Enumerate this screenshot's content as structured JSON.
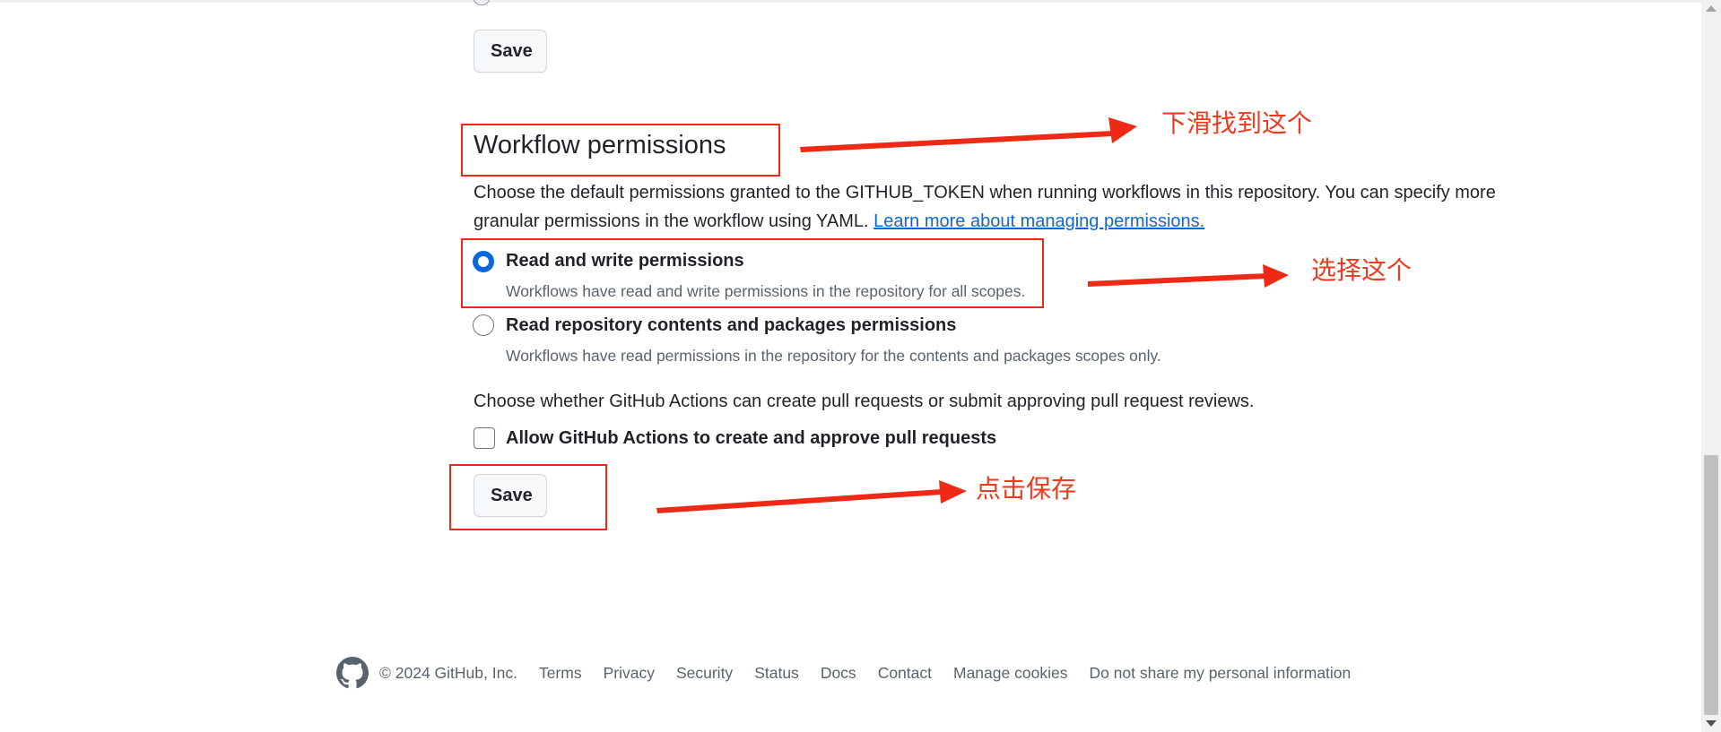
{
  "top": {
    "save_label": "Save"
  },
  "workflow": {
    "title": "Workflow permissions",
    "description": "Choose the default permissions granted to the GITHUB_TOKEN when running workflows in this repository. You can specify more granular permissions in the workflow using YAML. ",
    "learn_more_link": "Learn more about managing permissions.",
    "options": [
      {
        "label": "Read and write permissions",
        "note": "Workflows have read and write permissions in the repository for all scopes.",
        "selected": true
      },
      {
        "label": "Read repository contents and packages permissions",
        "note": "Workflows have read permissions in the repository for the contents and packages scopes only.",
        "selected": false
      }
    ],
    "pr_description": "Choose whether GitHub Actions can create pull requests or submit approving pull request reviews.",
    "allow_pr_label": "Allow GitHub Actions to create and approve pull requests",
    "allow_pr_checked": false,
    "save_label": "Save"
  },
  "annotations": {
    "scroll_hint": "下滑找到这个",
    "select_hint": "选择这个",
    "save_hint": "点击保存",
    "color": "#ee2a16"
  },
  "footer": {
    "logo_icon": "github-mark-icon",
    "copyright": "© 2024 GitHub, Inc.",
    "links": [
      "Terms",
      "Privacy",
      "Security",
      "Status",
      "Docs",
      "Contact",
      "Manage cookies",
      "Do not share my personal information"
    ]
  },
  "colors": {
    "accent": "#0969da",
    "text": "#1f2328",
    "muted": "#59636e"
  }
}
